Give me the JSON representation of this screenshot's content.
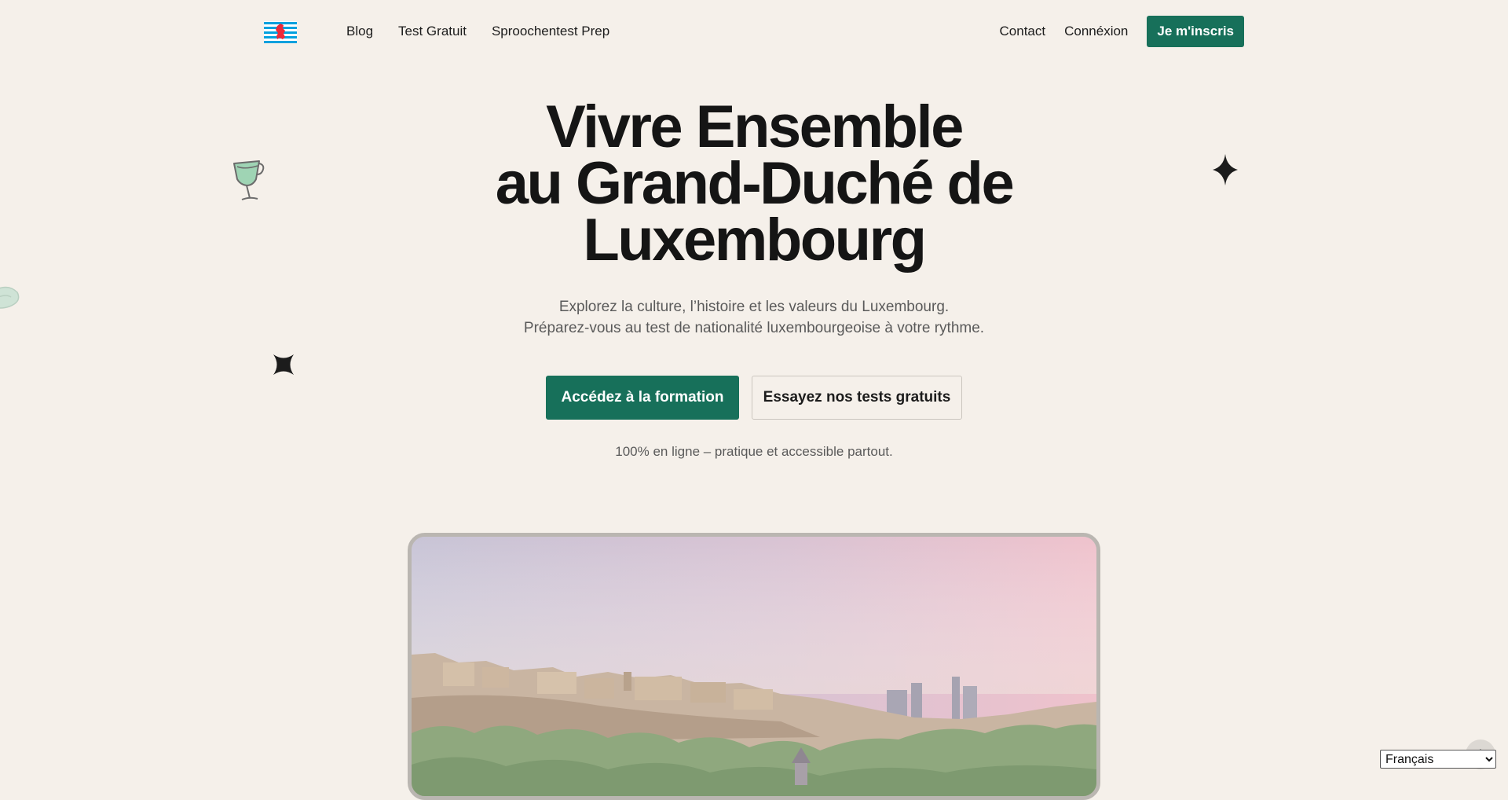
{
  "header": {
    "logo_icon": "luxembourg-lion-flag-logo",
    "nav": [
      {
        "label": "Blog"
      },
      {
        "label": "Test Gratuit"
      },
      {
        "label": "Sproochentest Prep"
      }
    ],
    "right_nav": [
      {
        "label": "Contact"
      },
      {
        "label": "Connéxion"
      }
    ],
    "signup_label": "Je m'inscris"
  },
  "hero": {
    "title_lines": [
      "Vivre Ensemble",
      "au Grand-Duché de",
      "Luxembourg"
    ],
    "subtitle_lines": [
      "Explorez la culture, l’histoire et les valeurs du Luxembourg.",
      "Préparez-vous au test de nationalité luxembourgeoise à votre rythme."
    ],
    "cta_primary": "Accédez à la formation",
    "cta_secondary": "Essayez nos tests gratuits",
    "note": "100% en ligne – pratique et accessible partout.",
    "image_icon": "luxembourg-city-panorama-photo"
  },
  "decorations": [
    "wine-glass-icon",
    "sparkle-star-icon",
    "four-point-star-icon",
    "leaf-blob-icon"
  ],
  "language": {
    "selected": "Français",
    "options": [
      "Français"
    ]
  },
  "colors": {
    "background": "#f5f0ea",
    "accent": "#17705a",
    "text": "#151515",
    "muted_text": "#5a5a5a",
    "flag_blue": "#00a1de",
    "flag_red": "#ed2939"
  }
}
